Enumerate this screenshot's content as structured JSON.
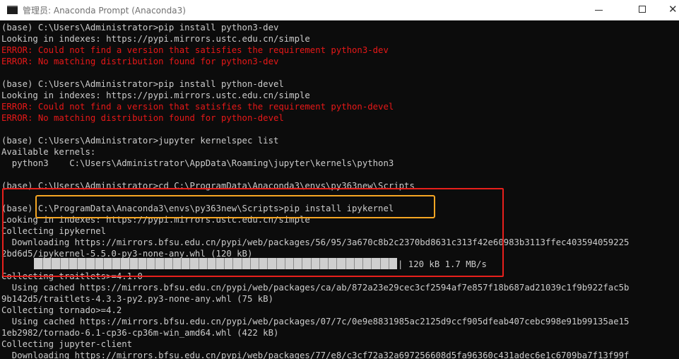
{
  "window": {
    "title": "管理员: Anaconda Prompt (Anaconda3)",
    "close_glyph": "✕"
  },
  "console": {
    "lines": [
      {
        "text": "(base) C:\\Users\\Administrator>pip install python3-dev",
        "kind": "normal"
      },
      {
        "text": "Looking in indexes: https://pypi.mirrors.ustc.edu.cn/simple",
        "kind": "normal"
      },
      {
        "text": "ERROR: Could not find a version that satisfies the requirement python3-dev",
        "kind": "error"
      },
      {
        "text": "ERROR: No matching distribution found for python3-dev",
        "kind": "error"
      },
      {
        "text": "",
        "kind": "normal"
      },
      {
        "text": "(base) C:\\Users\\Administrator>pip install python-devel",
        "kind": "normal"
      },
      {
        "text": "Looking in indexes: https://pypi.mirrors.ustc.edu.cn/simple",
        "kind": "normal"
      },
      {
        "text": "ERROR: Could not find a version that satisfies the requirement python-devel",
        "kind": "error"
      },
      {
        "text": "ERROR: No matching distribution found for python-devel",
        "kind": "error"
      },
      {
        "text": "",
        "kind": "normal"
      },
      {
        "text": "(base) C:\\Users\\Administrator>jupyter kernelspec list",
        "kind": "normal"
      },
      {
        "text": "Available kernels:",
        "kind": "normal"
      },
      {
        "text": "  python3    C:\\Users\\Administrator\\AppData\\Roaming\\jupyter\\kernels\\python3",
        "kind": "normal"
      },
      {
        "text": "",
        "kind": "normal"
      },
      {
        "text": "(base) C:\\Users\\Administrator>cd C:\\ProgramData\\Anaconda3\\envs\\py363new\\Scripts",
        "kind": "normal"
      },
      {
        "text": "",
        "kind": "normal"
      },
      {
        "text": "(base) C:\\ProgramData\\Anaconda3\\envs\\py363new\\Scripts>pip install ipykernel",
        "kind": "normal"
      },
      {
        "text": "Looking in indexes: https://pypi.mirrors.ustc.edu.cn/simple",
        "kind": "normal"
      },
      {
        "text": "Collecting ipykernel",
        "kind": "normal"
      },
      {
        "text": "  Downloading https://mirrors.bfsu.edu.cn/pypi/web/packages/56/95/3a670c8b2c2370bd8631c313f42e60983b3113ffec403594059225",
        "kind": "normal"
      },
      {
        "text": "2bd6d5/ipykernel-5.5.0-py3-none-any.whl (120 kB)",
        "kind": "normal"
      },
      {
        "text": "",
        "kind": "progress"
      },
      {
        "text": "Collecting traitlets>=4.1.0",
        "kind": "normal"
      },
      {
        "text": "  Using cached https://mirrors.bfsu.edu.cn/pypi/web/packages/ca/ab/872a23e29cec3cf2594af7e857f18b687ad21039c1f9b922fac5b",
        "kind": "normal"
      },
      {
        "text": "9b142d5/traitlets-4.3.3-py2.py3-none-any.whl (75 kB)",
        "kind": "normal"
      },
      {
        "text": "Collecting tornado>=4.2",
        "kind": "normal"
      },
      {
        "text": "  Using cached https://mirrors.bfsu.edu.cn/pypi/web/packages/07/7c/0e9e8831985ac2125d9ccf905dfeab407cebc998e91b99135ae15",
        "kind": "normal"
      },
      {
        "text": "1eb2982/tornado-6.1-cp36-cp36m-win_amd64.whl (422 kB)",
        "kind": "normal"
      },
      {
        "text": "Collecting jupyter-client",
        "kind": "normal"
      },
      {
        "text": "  Downloading https://mirrors.bfsu.edu.cn/pypi/web/packages/77/e8/c3cf72a32a697256608d5fa96360c431adec6e1c6709ba7f13f99f",
        "kind": "normal"
      }
    ],
    "progress": {
      "fraction": 1.0,
      "text": "| 120 kB 1.7 MB/s"
    }
  }
}
